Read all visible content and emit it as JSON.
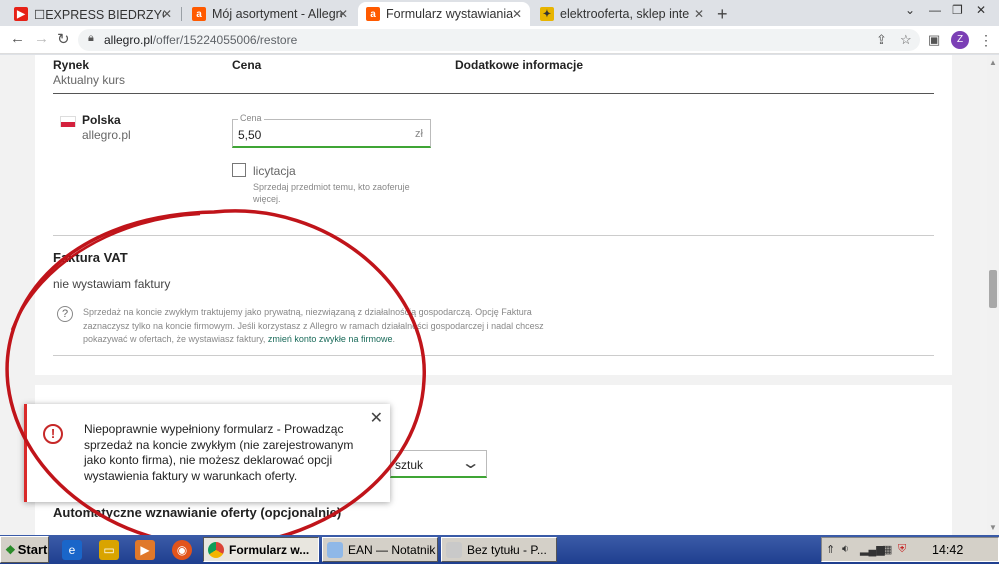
{
  "browser": {
    "tabs": [
      {
        "label": "☐EXPRESS BIEDRZYCKI",
        "icon": "youtube-icon",
        "active": false
      },
      {
        "label": "Mój asortyment - Allegro",
        "icon": "allegro-icon",
        "active": false
      },
      {
        "label": "Formularz wystawiania",
        "icon": "allegro-icon",
        "active": true
      },
      {
        "label": "elektrooferta, sklep inter",
        "icon": "shop-icon",
        "active": false
      }
    ],
    "url_host": "allegro.pl",
    "url_path": "/offer/15224055006/restore",
    "profile_initial": "Z"
  },
  "pricing": {
    "col_market": "Rynek",
    "col_market_sub": "Aktualny kurs",
    "col_price": "Cena",
    "col_info": "Dodatkowe informacje",
    "market_name": "Polska",
    "market_site": "allegro.pl",
    "price_label": "Cena",
    "price_value": "5,50",
    "currency": "zł",
    "auction_label": "licytacja",
    "auction_hint_1": "Sprzedaj przedmiot temu, kto zaoferuje",
    "auction_hint_2": "więcej."
  },
  "vat": {
    "title": "Faktura VAT",
    "value": "nie wystawiam faktury",
    "note_1": "Sprzedaż na koncie zwykłym traktujemy jako prywatną, niezwiązaną z działalnością gospodarczą. Opcję Faktura",
    "note_2": "zaznaczysz tylko na koncie firmowym. Jeśli korzystasz z Allegro w ramach działalności gospodarczej i nadal chcesz",
    "note_3": "pokazywać w ofertach, że wystawiasz faktury, ",
    "note_link": "zmień konto zwykłe na firmowe",
    "note_end": "."
  },
  "quantity": {
    "unit_value": "sztuk"
  },
  "resume": {
    "title": "Automatyczne wznawianie oferty (opcjonalnie)"
  },
  "toast": {
    "message": "Niepoprawnie wypełniony formularz - Prowadząc sprzedaż na koncie zwykłym (nie zarejestrowanym jako konto firma), nie możesz deklarować opcji wystawienia faktury w warunkach oferty."
  },
  "taskbar": {
    "start_label": "Start",
    "tasks": [
      {
        "label": "Formularz w...",
        "active": true
      },
      {
        "label": "EAN — Notatnik",
        "active": false
      },
      {
        "label": "Bez tytułu - P...",
        "active": false
      }
    ],
    "clock": "14:42"
  },
  "colors": {
    "allegro_orange": "#ff5a00",
    "success_green": "#3fa535",
    "error_red": "#c62828",
    "annotation_red": "#c0141a"
  }
}
